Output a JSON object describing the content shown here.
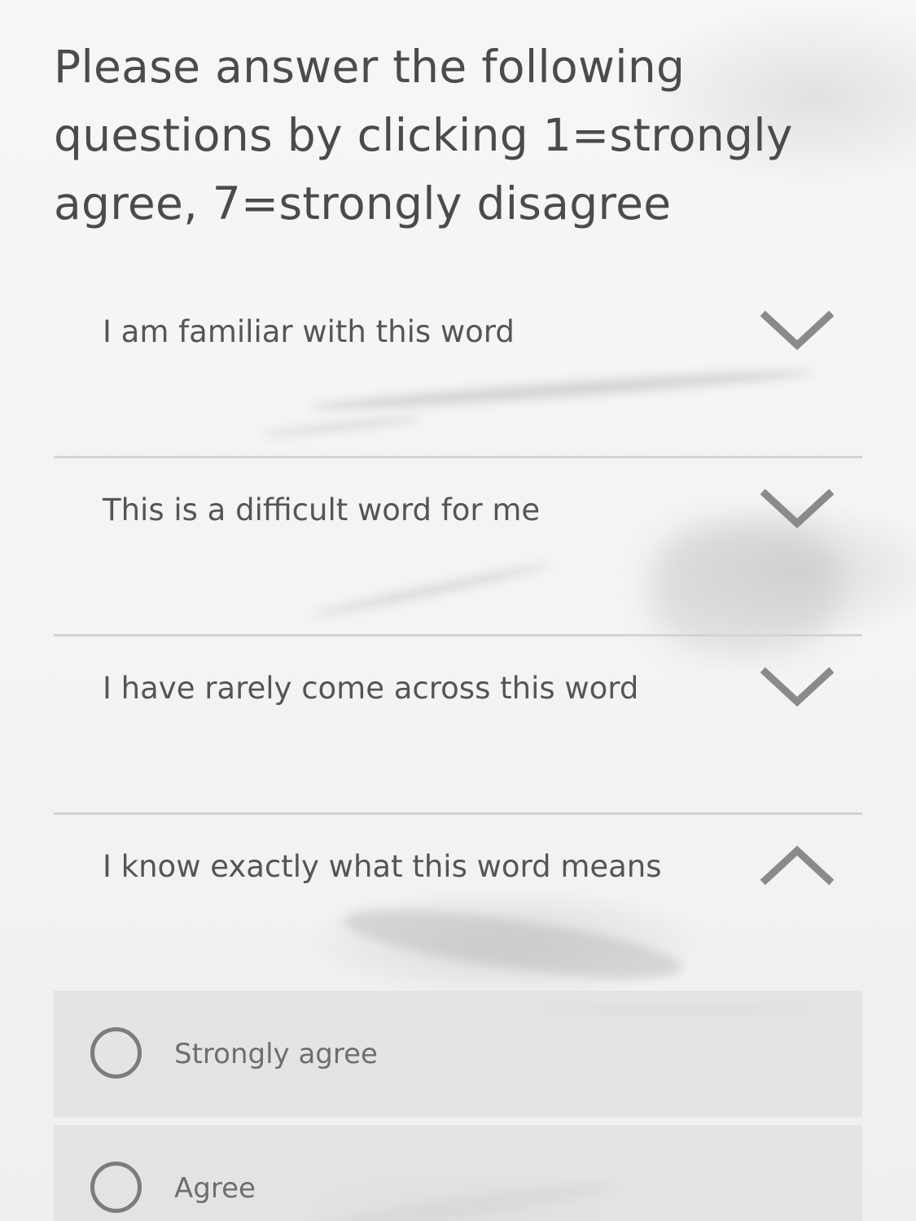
{
  "instructions": "Please answer the following questions by clicking 1=strongly agree, 7=strongly disagree",
  "questions": [
    {
      "label": "I am familiar with this word",
      "expanded": false
    },
    {
      "label": "This is a difficult word for me",
      "expanded": false
    },
    {
      "label": "I have rarely come across this word",
      "expanded": false
    },
    {
      "label": "I know exactly what this word means",
      "expanded": true
    }
  ],
  "options": [
    {
      "label": "Strongly agree",
      "selected": false
    },
    {
      "label": "Agree",
      "selected": false
    }
  ],
  "colors": {
    "text": "#4b4b4b",
    "divider": "#d4d4d4",
    "chevron": "#8a8a8a",
    "option_bg": "#e1e1e1",
    "radio_border": "#7c7c7c"
  },
  "icons": {
    "collapsed": "chevron-down-icon",
    "expanded": "chevron-up-icon",
    "radio": "radio-unchecked-icon"
  }
}
